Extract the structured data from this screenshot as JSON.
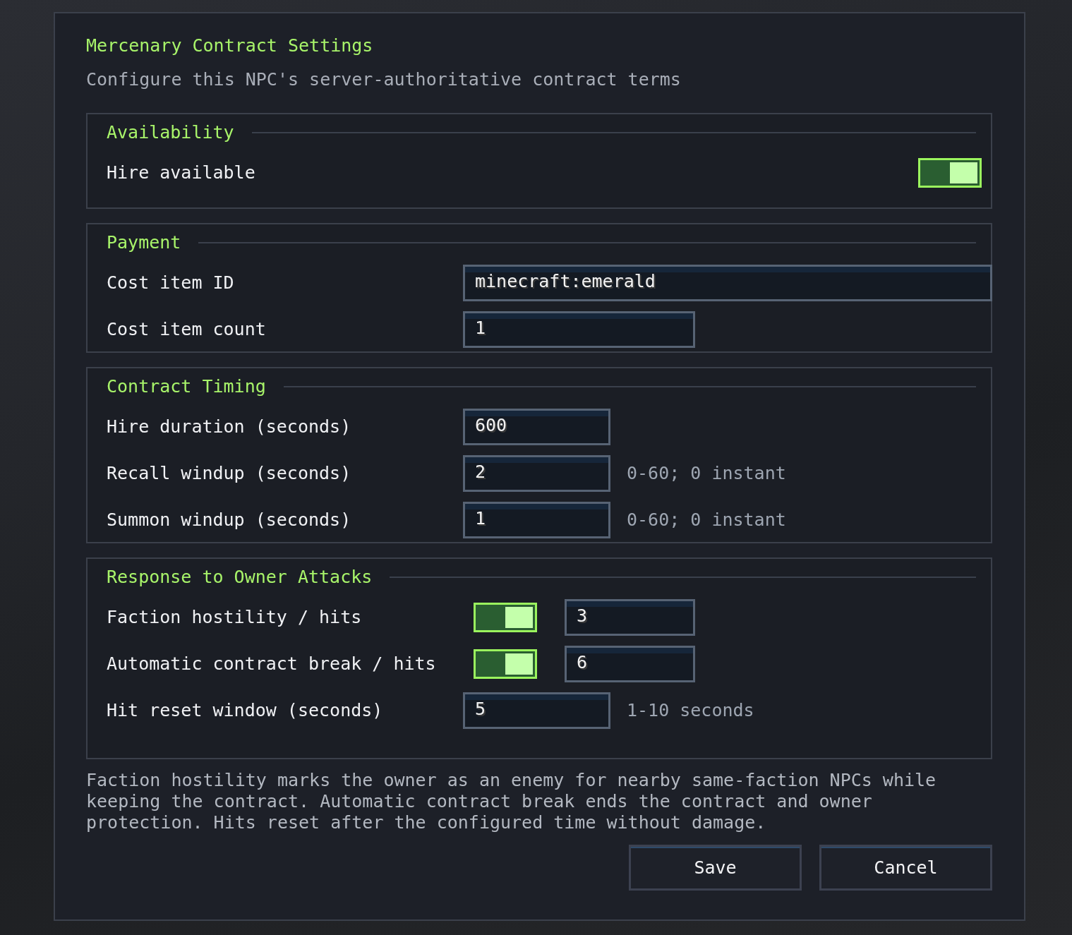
{
  "dialog": {
    "title": "Mercenary Contract Settings",
    "subtitle": "Configure this NPC's server-authoritative contract terms",
    "sections": [
      {
        "title": "Availability",
        "rows": [
          {
            "kind": "toggle",
            "label": "Hire available",
            "on": true
          }
        ]
      },
      {
        "title": "Payment",
        "rows": [
          {
            "kind": "id-field",
            "label": "Cost item ID",
            "value": "minecraft:emerald"
          },
          {
            "kind": "count-field",
            "label": "Cost item count",
            "value": "1"
          }
        ]
      },
      {
        "title": "Contract Timing",
        "rows": [
          {
            "kind": "seconds-field",
            "label": "Hire duration (seconds)",
            "value": "600"
          },
          {
            "kind": "seconds-field",
            "label": "Recall windup (seconds)",
            "value": "2",
            "hint": "0-60; 0 instant"
          },
          {
            "kind": "seconds-field",
            "label": "Summon windup (seconds)",
            "value": "1",
            "hint": "0-60; 0 instant"
          }
        ]
      },
      {
        "title": "Response to Owner Attacks",
        "rows": [
          {
            "kind": "toggle-field",
            "label": "Faction hostility / hits",
            "on": true,
            "value": "3"
          },
          {
            "kind": "toggle-field",
            "label": "Automatic contract break / hits",
            "on": true,
            "value": "6"
          },
          {
            "kind": "seconds-field",
            "label": "Hit reset window (seconds)",
            "value": "5",
            "hint": "1-10 seconds"
          }
        ]
      }
    ],
    "note": "Faction hostility marks the owner as an enemy for nearby same-faction NPCs while keeping the contract. Automatic contract break ends the contract and owner protection. Hits reset after the configured time without damage.",
    "buttons": [
      "Save",
      "Cancel"
    ]
  }
}
